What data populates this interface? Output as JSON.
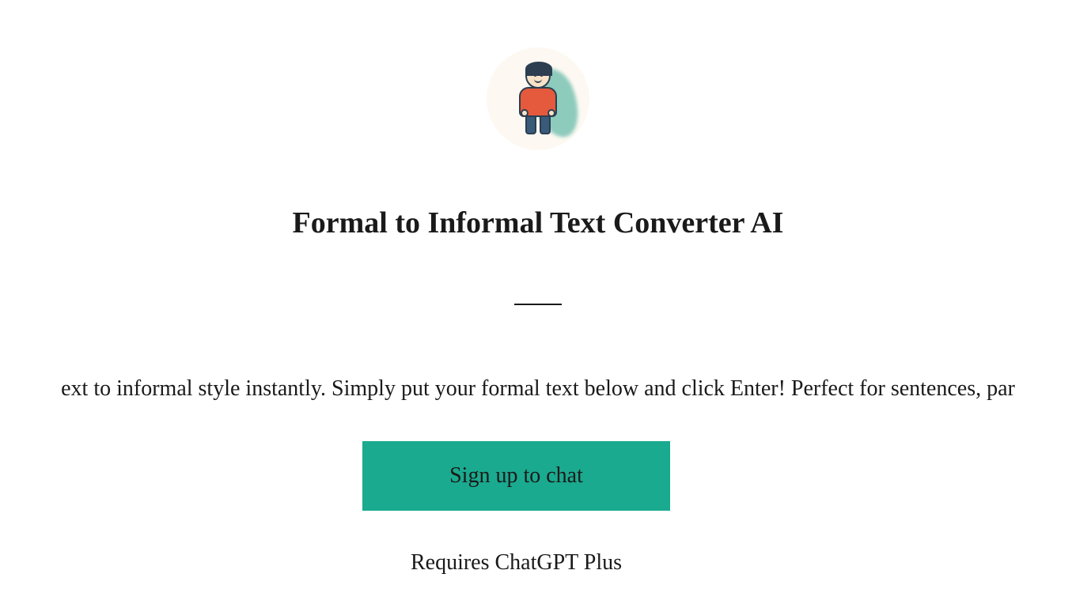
{
  "page": {
    "title": "Formal to Informal Text Converter AI",
    "description": "ext to informal style instantly. Simply put your formal text below and click Enter! Perfect for sentences, par",
    "cta_label": "Sign up to chat",
    "requires_label": "Requires ChatGPT Plus"
  },
  "avatar": {
    "name": "person-avatar"
  },
  "colors": {
    "accent": "#1aaa8f",
    "text": "#1a1a1a",
    "avatar_shirt": "#e55a3c",
    "avatar_bg": "#fdf9f2"
  }
}
